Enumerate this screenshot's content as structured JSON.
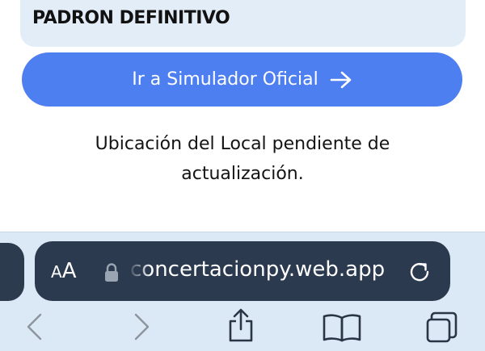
{
  "padron_card": {
    "title": "PADRON DEFINITIVO"
  },
  "simulator_button": {
    "label": "Ir a Simulador Oficial",
    "icon": "arrow-right-icon",
    "color": "#4d7ff0"
  },
  "message": {
    "text": "Ubicación del Local pendiente de actualización."
  },
  "safari": {
    "reader_small": "A",
    "reader_big": "A",
    "url": "concertacionpy.web.app",
    "icons": {
      "lock": "lock-icon",
      "reload": "reload-icon",
      "back": "chevron-left-icon",
      "forward": "chevron-right-icon",
      "share": "share-icon",
      "bookmarks": "book-icon",
      "tabs": "tabs-icon"
    },
    "bar_color": "#dbe8f6",
    "address_color": "#2b3a4e"
  }
}
